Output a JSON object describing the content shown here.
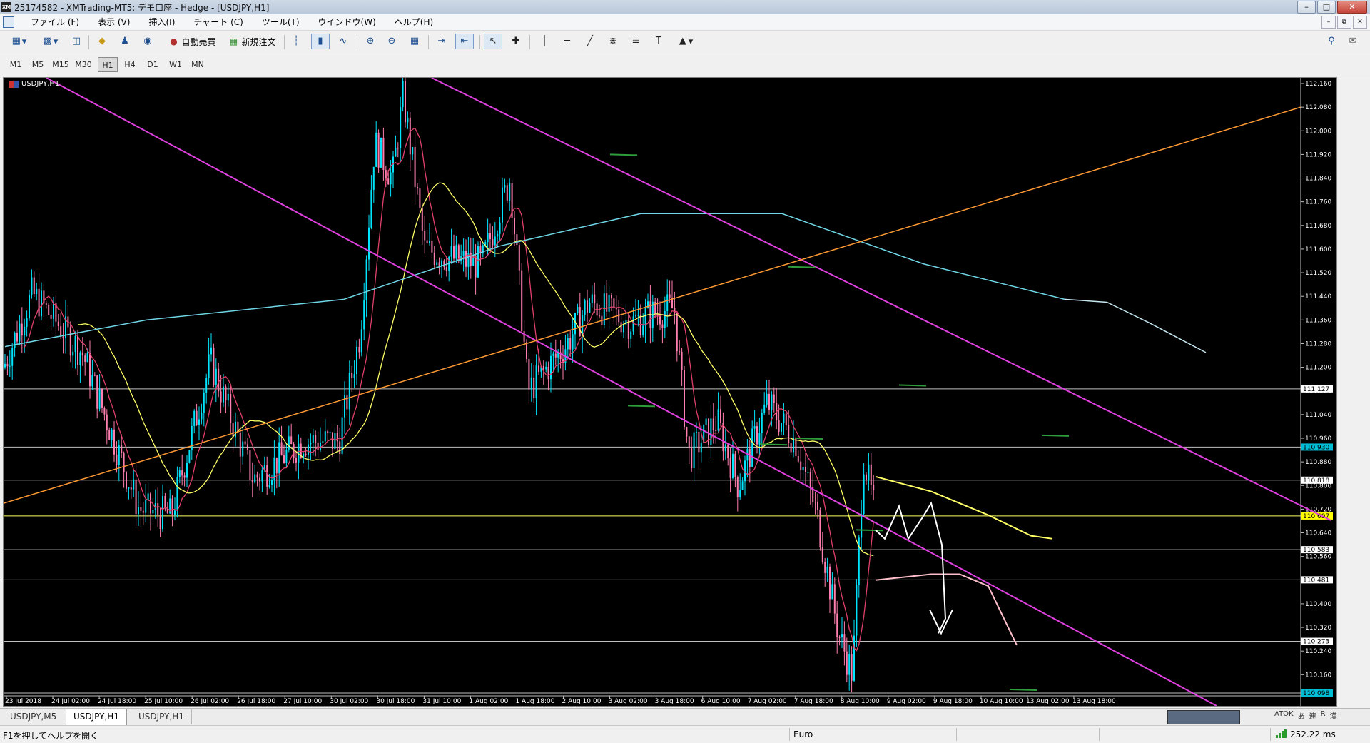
{
  "window": {
    "title": "25174582 - XMTrading-MT5: デモ口座 - Hedge - [USDJPY,H1]",
    "logo": "XM"
  },
  "menu": [
    "ファイル (F)",
    "表示 (V)",
    "挿入(I)",
    "チャート (C)",
    "ツール(T)",
    "ウインドウ(W)",
    "ヘルプ(H)"
  ],
  "toolbar": {
    "auto_trade": "自動売買",
    "new_order": "新規注文"
  },
  "timeframes": [
    "M1",
    "M5",
    "M15",
    "M30",
    "H1",
    "H4",
    "D1",
    "W1",
    "MN"
  ],
  "active_timeframe": "H1",
  "chart_data": {
    "type": "candlestick",
    "symbol": "USDJPY,H1",
    "ylim": [
      110.098,
      112.16
    ],
    "y_ticks": [
      112.16,
      112.08,
      112.0,
      111.92,
      111.84,
      111.76,
      111.68,
      111.6,
      111.52,
      111.44,
      111.36,
      111.28,
      111.2,
      111.12,
      111.04,
      110.96,
      110.88,
      110.8,
      110.72,
      110.64,
      110.56,
      110.48,
      110.4,
      110.32,
      110.24,
      110.16
    ],
    "y_tick_labels": [
      "112.160",
      "112.080",
      "112.000",
      "111.920",
      "111.840",
      "111.760",
      "111.680",
      "111.600",
      "111.520",
      "111.440",
      "111.360",
      "111.280",
      "111.200",
      "111.120",
      "111.040",
      "110.960",
      "110.880",
      "110.800",
      "110.720",
      "110.640",
      "110.560",
      "110.480",
      "110.400",
      "110.320",
      "110.240",
      "110.160"
    ],
    "x_labels": [
      "23 Jul 2018",
      "24 Jul 02:00",
      "24 Jul 18:00",
      "25 Jul 10:00",
      "26 Jul 02:00",
      "26 Jul 18:00",
      "27 Jul 10:00",
      "30 Jul 02:00",
      "30 Jul 18:00",
      "31 Jul 10:00",
      "1 Aug 02:00",
      "1 Aug 18:00",
      "2 Aug 10:00",
      "3 Aug 02:00",
      "3 Aug 18:00",
      "6 Aug 10:00",
      "7 Aug 02:00",
      "7 Aug 18:00",
      "8 Aug 10:00",
      "9 Aug 02:00",
      "9 Aug 18:00",
      "10 Aug 10:00",
      "13 Aug 02:00",
      "13 Aug 18:00"
    ],
    "horizontal_levels": [
      {
        "price": 111.127,
        "label": "111.127",
        "line_color": "#c0c0c0",
        "tag_bg": "#ffffff",
        "tag_fg": "#000000"
      },
      {
        "price": 110.93,
        "label": "110.930",
        "line_color": "#c0c0c0",
        "tag_bg": "#00bcd4",
        "tag_fg": "#000000"
      },
      {
        "price": 110.818,
        "label": "110.818",
        "line_color": "#c0c0c0",
        "tag_bg": "#ffffff",
        "tag_fg": "#000000"
      },
      {
        "price": 110.697,
        "label": "110.697",
        "line_color": "#ffff66",
        "tag_bg": "#ffff00",
        "tag_fg": "#000000"
      },
      {
        "price": 110.583,
        "label": "110.583",
        "line_color": "#c0c0c0",
        "tag_bg": "#ffffff",
        "tag_fg": "#000000"
      },
      {
        "price": 110.481,
        "label": "110.481",
        "line_color": "#c0c0c0",
        "tag_bg": "#ffffff",
        "tag_fg": "#000000"
      },
      {
        "price": 110.273,
        "label": "110.273",
        "line_color": "#c0c0c0",
        "tag_bg": "#ffffff",
        "tag_fg": "#000000"
      },
      {
        "price": 110.098,
        "label": "110.098",
        "line_color": "#c0c0c0",
        "tag_bg": "#00bcd4",
        "tag_fg": "#000000"
      }
    ],
    "colors": {
      "bull": "#00e5ff",
      "bear": "#ff7fb0",
      "ma_fast": "#e0406a",
      "ma_mid": "#ffff66",
      "ma_slow": "#6fd6e6",
      "channel": "#e040e0",
      "trendline": "#ff9933",
      "sr_marks": "#2e9e3a",
      "forecast": "#ffffff",
      "forecast_ma": "#ffc0cb"
    }
  },
  "tabs": [
    "USDJPY,M5",
    "USDJPY,H1",
    "USDJPY,H1"
  ],
  "active_tab": 1,
  "tabs_right": [
    "ATOK",
    "あ",
    "連",
    "R",
    "漢"
  ],
  "status": {
    "help": "F1を押してヘルプを開く",
    "profile": "Euro",
    "ping": "252.22 ms"
  }
}
